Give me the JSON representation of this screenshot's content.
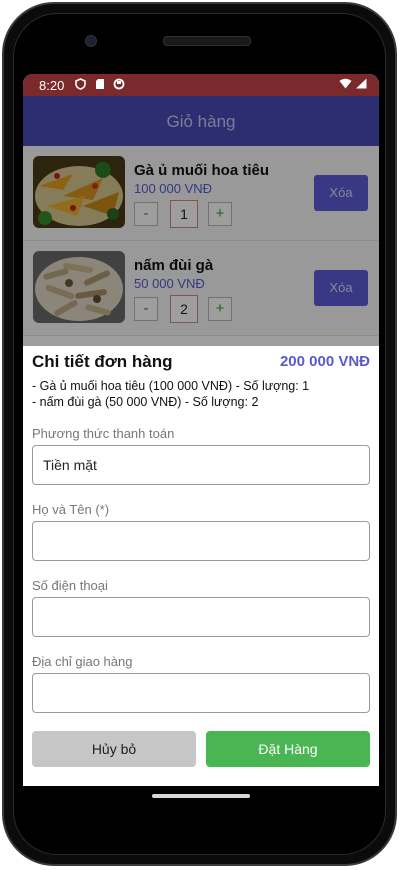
{
  "status_bar": {
    "time": "8:20",
    "icons": [
      "shield-icon",
      "sd-card-icon",
      "circle-icon"
    ],
    "right_icons": [
      "wifi-icon",
      "signal-icon"
    ]
  },
  "app_bar": {
    "title": "Giỏ hàng"
  },
  "cart": {
    "items": [
      {
        "name": "Gà ủ muối hoa tiêu",
        "price": "100 000 VNĐ",
        "minus": "-",
        "quantity": "1",
        "plus": "+",
        "delete_label": "Xóa"
      },
      {
        "name": "nấm đùi gà",
        "price": "50 000 VNĐ",
        "minus": "-",
        "quantity": "2",
        "plus": "+",
        "delete_label": "Xóa"
      }
    ]
  },
  "order_sheet": {
    "title": "Chi tiết đơn hàng",
    "total": "200 000 VNĐ",
    "lines": [
      "- Gà ủ muối hoa tiêu (100 000 VNĐ) - Số lượng: 1",
      "- nấm đùi gà (50 000 VNĐ) - Số lượng: 2"
    ],
    "payment_label": "Phương thức thanh toán",
    "payment_value": "Tiền mặt",
    "name_label": "Họ và Tên (*)",
    "name_value": "",
    "phone_label": "Số điện thoại",
    "phone_value": "",
    "address_label": "Địa chỉ giao hàng",
    "address_value": "",
    "cancel_label": "Hủy bỏ",
    "order_label": "Đặt Hàng"
  },
  "colors": {
    "accent": "#5b5bd6",
    "status_bar": "#7a2a2c",
    "app_bar": "#4a4ab8",
    "order_button": "#49b553",
    "cancel_button": "#c6c6c6",
    "price": "#5a5ad0"
  }
}
